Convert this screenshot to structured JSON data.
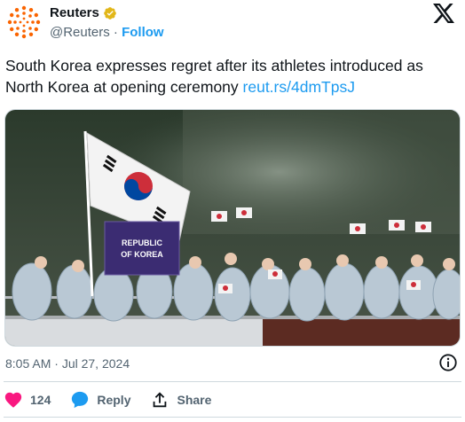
{
  "author": {
    "display_name": "Reuters",
    "handle": "@Reuters",
    "separator": "·",
    "follow_label": "Follow"
  },
  "tweet": {
    "text": "South Korea expresses regret after its athletes introduced as North Korea at opening ceremony",
    "link": "reut.rs/4dmTpsJ"
  },
  "media": {
    "banner_text_line1": "REPUBLIC",
    "banner_text_line2": "OF KOREA"
  },
  "meta": {
    "time": "8:05 AM",
    "separator": "·",
    "date": "Jul 27, 2024"
  },
  "actions": {
    "like_count": "124",
    "reply_label": "Reply",
    "share_label": "Share"
  },
  "colors": {
    "accent": "#1d9bf0",
    "like": "#f91880",
    "reuters_orange": "#fa6400",
    "verified_gold": "#e2b719"
  }
}
